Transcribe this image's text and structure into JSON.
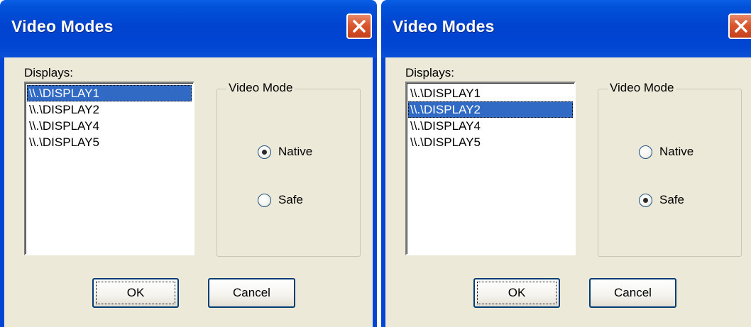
{
  "dialogs": [
    {
      "title": "Video Modes",
      "displays_label": "Displays:",
      "displays": [
        "\\\\.\\DISPLAY1",
        "\\\\.\\DISPLAY2",
        "\\\\.\\DISPLAY4",
        "\\\\.\\DISPLAY5"
      ],
      "selected_display": "\\\\.\\DISPLAY1",
      "group_label": "Video Mode",
      "options": [
        "Native",
        "Safe"
      ],
      "selected_mode": "Native",
      "ok_label": "OK",
      "cancel_label": "Cancel"
    },
    {
      "title": "Video Modes",
      "displays_label": "Displays:",
      "displays": [
        "\\\\.\\DISPLAY1",
        "\\\\.\\DISPLAY2",
        "\\\\.\\DISPLAY4",
        "\\\\.\\DISPLAY5"
      ],
      "selected_display": "\\\\.\\DISPLAY2",
      "group_label": "Video Mode",
      "options": [
        "Native",
        "Safe"
      ],
      "selected_mode": "Safe",
      "ok_label": "OK",
      "cancel_label": "Cancel"
    }
  ],
  "colors": {
    "title_bar": "#0046d3",
    "dialog_face": "#ece9d8",
    "selection": "#316ac5",
    "close_button": "#d9562e"
  },
  "icons": {
    "close": "close-icon"
  }
}
